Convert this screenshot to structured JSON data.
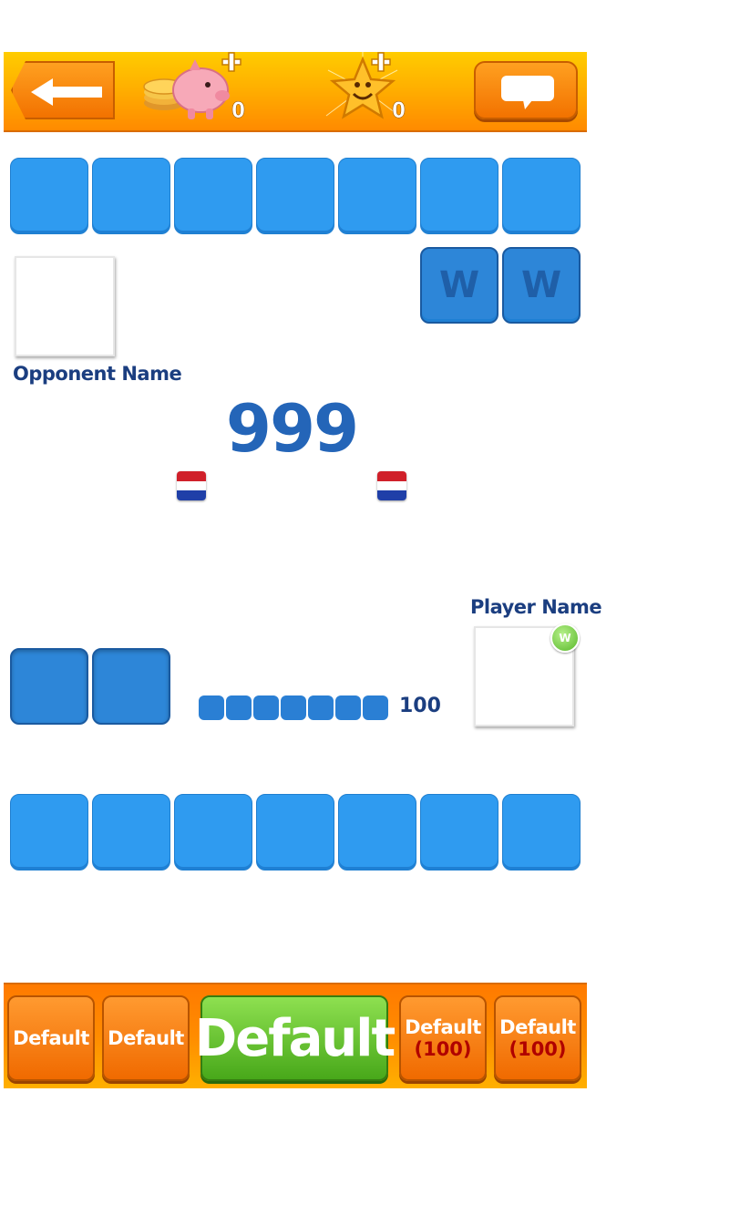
{
  "topbar": {
    "coins_count": "0",
    "stars_count": "0",
    "icons": {
      "back": "back-arrow-icon",
      "coins": "piggy-bank-coins-icon",
      "stars": "smiling-star-icon",
      "chat": "chat-bubble-icon"
    },
    "colors": {
      "bar_top": "#ffcc00",
      "bar_bottom": "#ff8a00",
      "button": "#f27200"
    }
  },
  "opponent": {
    "name": "Opponent Name",
    "flag": "netherlands-flag-icon",
    "tiles": [
      "",
      "",
      "",
      "",
      "",
      "",
      ""
    ],
    "special_tiles": [
      "W",
      "W"
    ]
  },
  "score": "999",
  "player": {
    "name": "Player Name",
    "flag": "netherlands-flag-icon",
    "badge": "W",
    "bag_count": "100",
    "bag_pips": 7,
    "held_tiles": [
      "",
      ""
    ],
    "rack_tiles": [
      "",
      "",
      "",
      "",
      "",
      "",
      ""
    ]
  },
  "bottombar": {
    "buttons": [
      {
        "label": "Default",
        "cost": ""
      },
      {
        "label": "Default",
        "cost": ""
      },
      {
        "label": "Default",
        "cost": ""
      },
      {
        "label": "Default",
        "cost": "(100)"
      },
      {
        "label": "Default",
        "cost": "(100)"
      }
    ]
  },
  "colors": {
    "tile": "#2f9bf0",
    "tile_dark": "#2d86d8",
    "name_text": "#1b3e80",
    "score_text": "#2465b8",
    "primary_button": "#48a81a"
  }
}
